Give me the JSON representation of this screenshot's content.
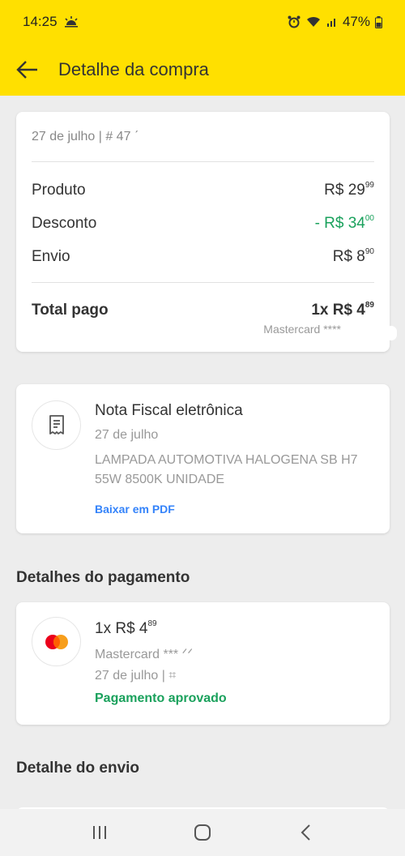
{
  "status_bar": {
    "time": "14:25",
    "battery": "47%"
  },
  "header": {
    "title": "Detalhe da compra"
  },
  "summary": {
    "date_order": "27 de julho  |  # 47 ˊ",
    "rows": [
      {
        "label": "Produto",
        "price_main": "R$ 29",
        "price_cents": "99"
      },
      {
        "label": "Desconto",
        "price_main": "- R$ 34",
        "price_cents": "00"
      },
      {
        "label": "Envio",
        "price_main": "R$ 8",
        "price_cents": "90"
      }
    ],
    "total_label": "Total pago",
    "total_main": "1x R$ 4",
    "total_cents": "89",
    "card_info": "Mastercard ****",
    "colors": {
      "discount": "#1aa15c"
    }
  },
  "nota_fiscal": {
    "title": "Nota Fiscal eletrônica",
    "date": "27 de julho",
    "description": "LAMPADA AUTOMOTIVA HALOGENA SB H7 55W 8500K UNIDADE",
    "link": "Baixar em PDF",
    "icon": "receipt-icon"
  },
  "payment": {
    "section_title": "Detalhes do pagamento",
    "amount_main": "1x R$ 4",
    "amount_cents": "89",
    "card_text": "Mastercard *** ᐟᐟ",
    "date": "27 de julho  |  ⌗",
    "status": "Pagamento aprovado",
    "icon": "mastercard-icon"
  },
  "shipping": {
    "section_title": "Detalhe do envio"
  },
  "theme": {
    "brand_yellow": "#ffe000",
    "link_blue": "#3483fa",
    "success_green": "#1aa15c"
  }
}
